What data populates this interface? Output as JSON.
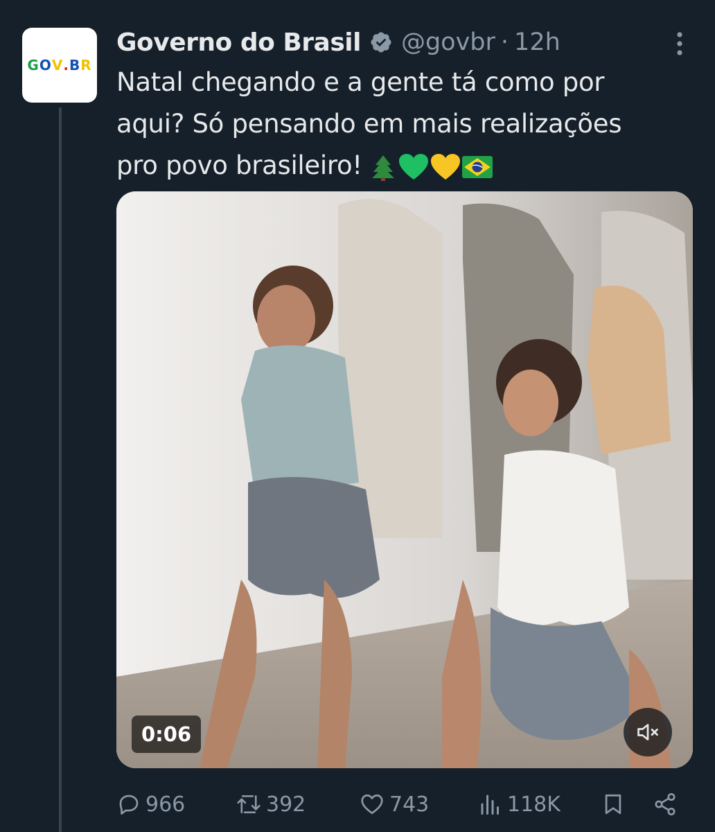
{
  "author": {
    "name": "Governo do Brasil",
    "handle": "@govbr",
    "separator": "·",
    "time": "12h",
    "avatar_logo_letters": [
      "G",
      "O",
      "V",
      ".",
      "B",
      "R"
    ],
    "avatar_logo_colors": [
      "#1b9e4b",
      "#1351b4",
      "#f2c200",
      "#e52207",
      "#1351b4",
      "#f2c200"
    ],
    "verified_icon": "verified-badge-icon"
  },
  "tweet": {
    "text_lines": [
      "Natal chegando e a gente tá como por",
      "aqui? Só pensando em mais realizações",
      "pro povo brasileiro!"
    ],
    "emojis": [
      "christmas-tree-icon",
      "green-heart-icon",
      "yellow-heart-icon",
      "brazil-flag-icon"
    ]
  },
  "video": {
    "duration": "0:06",
    "mute_icon": "speaker-muted-icon"
  },
  "actions": {
    "replies": "966",
    "reposts": "392",
    "likes": "743",
    "views": "118K"
  },
  "colors": {
    "background": "#15202b",
    "text": "#e7e9ea",
    "secondary": "#8b98a5",
    "verified": "#8b98a5"
  }
}
